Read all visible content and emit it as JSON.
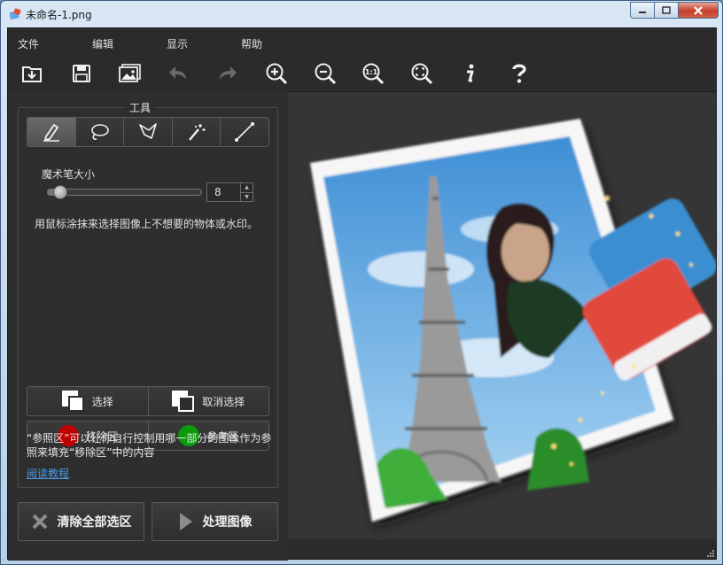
{
  "window": {
    "title": "未命名-1.png"
  },
  "menu": {
    "items": [
      "文件",
      "编辑",
      "显示",
      "帮助"
    ]
  },
  "toolbar": {
    "buttons": [
      "open-icon",
      "save-icon",
      "image-icon",
      "undo-icon",
      "redo-icon",
      "zoom-in-icon",
      "zoom-out-icon",
      "zoom-actual-icon",
      "zoom-fit-icon",
      "info-icon",
      "help-icon"
    ],
    "actual_size_label": "1:1"
  },
  "tools": {
    "title": "工具",
    "active_tool": "marker",
    "brush_size_label": "魔术笔大小",
    "brush_size_value": "8",
    "brush_size_position": 0.08,
    "hint": "用鼠标涂抹来选择图像上不想要的物体或水印。"
  },
  "selection": {
    "select_label": "选择",
    "deselect_label": "取消选择"
  },
  "areas": {
    "remove_label": "移除区",
    "reference_label": "参考区",
    "remove_color": "#c00000",
    "reference_color": "#0a9a0a"
  },
  "info": {
    "text": "“参照区”可以让你自行控制用哪一部分的图像作为参照来填充“移除区”中的内容",
    "tutorial_link": "阅读教程"
  },
  "actions": {
    "clear_label": "清除全部选区",
    "process_label": "处理图像"
  }
}
